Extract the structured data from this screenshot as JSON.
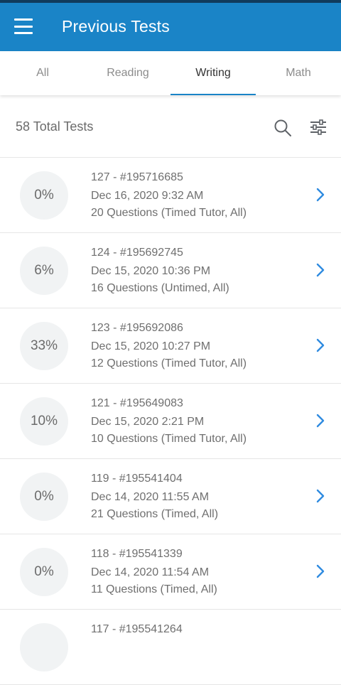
{
  "header": {
    "title": "Previous Tests"
  },
  "tabs": [
    {
      "label": "All"
    },
    {
      "label": "Reading"
    },
    {
      "label": "Writing"
    },
    {
      "label": "Math"
    }
  ],
  "active_tab": "Writing",
  "toolbar": {
    "total": "58 Total Tests"
  },
  "tests": [
    {
      "score": "0%",
      "id": "127 - #195716685",
      "date": "Dec 16, 2020 9:32 AM",
      "details": "20 Questions (Timed Tutor, All)"
    },
    {
      "score": "6%",
      "id": "124 - #195692745",
      "date": "Dec 15, 2020 10:36 PM",
      "details": "16 Questions (Untimed, All)"
    },
    {
      "score": "33%",
      "id": "123 - #195692086",
      "date": "Dec 15, 2020 10:27 PM",
      "details": "12 Questions (Timed Tutor, All)"
    },
    {
      "score": "10%",
      "id": "121 - #195649083",
      "date": "Dec 15, 2020 2:21 PM",
      "details": "10 Questions (Timed Tutor, All)"
    },
    {
      "score": "0%",
      "id": "119 - #195541404",
      "date": "Dec 14, 2020 11:55 AM",
      "details": "21 Questions (Timed, All)"
    },
    {
      "score": "0%",
      "id": "118 - #195541339",
      "date": "Dec 14, 2020 11:54 AM",
      "details": "11 Questions (Timed, All)"
    },
    {
      "score": "",
      "id": "117 - #195541264",
      "date": "",
      "details": ""
    }
  ],
  "colors": {
    "primary": "#1a84c7",
    "accent_chevron": "#2f8be0"
  }
}
